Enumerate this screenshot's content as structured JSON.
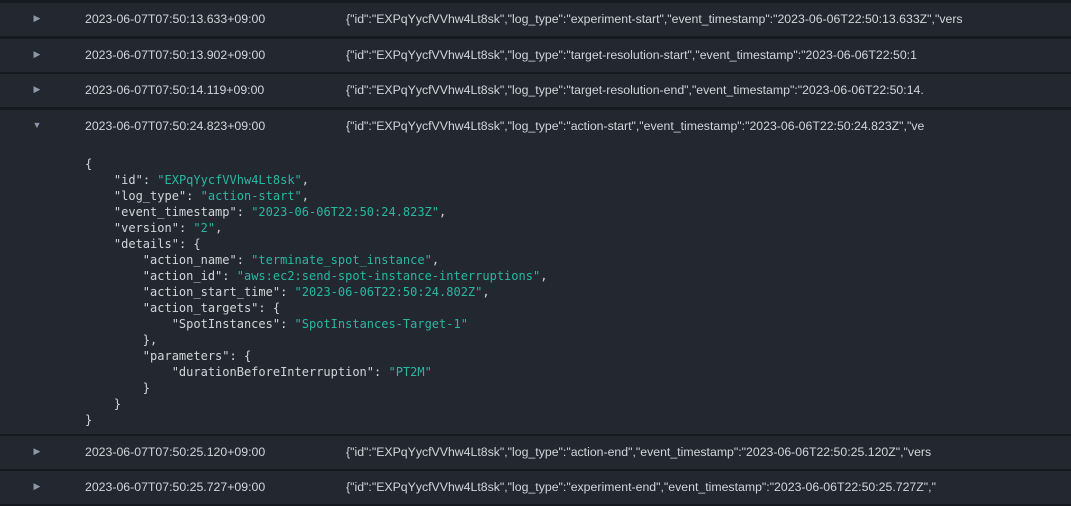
{
  "colors": {
    "background": "#16191f",
    "row": "#232730",
    "text": "#d1d5db",
    "json_string": "#28b8a2",
    "toggle": "#8d99a8"
  },
  "icons": {
    "collapsed": "caret-right-icon",
    "expanded": "caret-down-icon"
  },
  "rows": [
    {
      "timestamp": "2023-06-07T07:50:13.633+09:00",
      "message": "{\"id\":\"EXPqYycfVVhw4Lt8sk\",\"log_type\":\"experiment-start\",\"event_timestamp\":\"2023-06-06T22:50:13.633Z\",\"vers",
      "expanded": false
    },
    {
      "timestamp": "2023-06-07T07:50:13.902+09:00",
      "message": "{\"id\":\"EXPqYycfVVhw4Lt8sk\",\"log_type\":\"target-resolution-start\",\"event_timestamp\":\"2023-06-06T22:50:1",
      "expanded": false
    },
    {
      "timestamp": "2023-06-07T07:50:14.119+09:00",
      "message": "{\"id\":\"EXPqYycfVVhw4Lt8sk\",\"log_type\":\"target-resolution-end\",\"event_timestamp\":\"2023-06-06T22:50:14.",
      "expanded": false
    },
    {
      "timestamp": "2023-06-07T07:50:24.823+09:00",
      "message": "{\"id\":\"EXPqYycfVVhw4Lt8sk\",\"log_type\":\"action-start\",\"event_timestamp\":\"2023-06-06T22:50:24.823Z\",\"ve",
      "expanded": true
    },
    {
      "timestamp": "2023-06-07T07:50:25.120+09:00",
      "message": "{\"id\":\"EXPqYycfVVhw4Lt8sk\",\"log_type\":\"action-end\",\"event_timestamp\":\"2023-06-06T22:50:25.120Z\",\"vers",
      "expanded": false
    },
    {
      "timestamp": "2023-06-07T07:50:25.727+09:00",
      "message": "{\"id\":\"EXPqYycfVVhw4Lt8sk\",\"log_type\":\"experiment-end\",\"event_timestamp\":\"2023-06-06T22:50:25.727Z\",\"",
      "expanded": false
    }
  ],
  "expanded_json": {
    "id": "EXPqYycfVVhw4Lt8sk",
    "log_type": "action-start",
    "event_timestamp": "2023-06-06T22:50:24.823Z",
    "version": "2",
    "details": {
      "action_name": "terminate_spot_instance",
      "action_id": "aws:ec2:send-spot-instance-interruptions",
      "action_start_time": "2023-06-06T22:50:24.802Z",
      "action_targets": {
        "SpotInstances": "SpotInstances-Target-1"
      },
      "parameters": {
        "durationBeforeInterruption": "PT2M"
      }
    }
  }
}
